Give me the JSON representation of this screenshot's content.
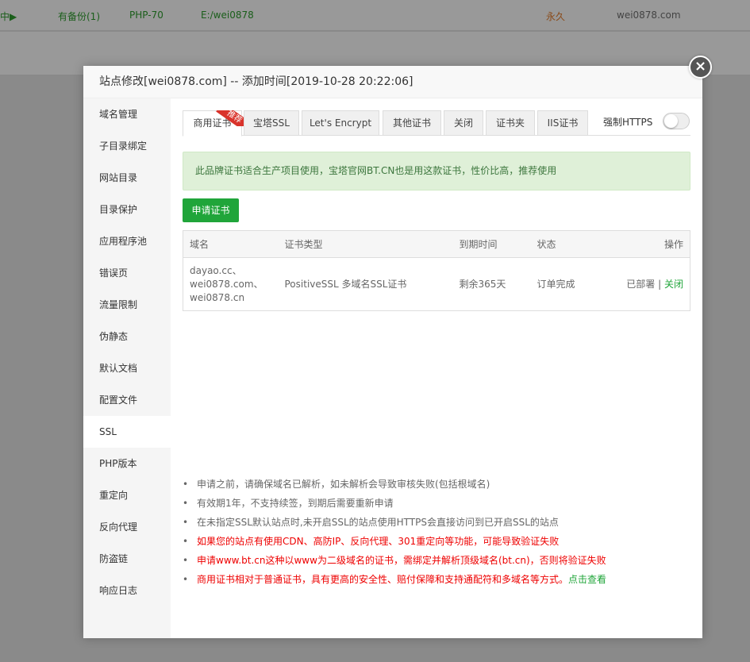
{
  "background": {
    "status": "中▶",
    "backup": "有备份(1)",
    "php": "PHP-70",
    "path": "E:/wei0878",
    "expire": "永久",
    "domain": "wei0878.com"
  },
  "modal": {
    "title": "站点修改[wei0878.com] -- 添加时间[2019-10-28 20:22:06]",
    "close_label": "×"
  },
  "sidebar": {
    "items": [
      {
        "label": "域名管理"
      },
      {
        "label": "子目录绑定"
      },
      {
        "label": "网站目录"
      },
      {
        "label": "目录保护"
      },
      {
        "label": "应用程序池"
      },
      {
        "label": "错误页"
      },
      {
        "label": "流量限制"
      },
      {
        "label": "伪静态"
      },
      {
        "label": "默认文档"
      },
      {
        "label": "配置文件"
      },
      {
        "label": "SSL"
      },
      {
        "label": "PHP版本"
      },
      {
        "label": "重定向"
      },
      {
        "label": "反向代理"
      },
      {
        "label": "防盗链"
      },
      {
        "label": "响应日志"
      }
    ],
    "active": "SSL"
  },
  "tabs": {
    "items": [
      {
        "label": "商用证书"
      },
      {
        "label": "宝塔SSL"
      },
      {
        "label": "Let's Encrypt"
      },
      {
        "label": "其他证书"
      },
      {
        "label": "关闭"
      },
      {
        "label": "证书夹"
      },
      {
        "label": "IIS证书"
      }
    ],
    "ribbon": "推荐",
    "force_https_label": "强制HTTPS",
    "force_https_on": false
  },
  "alert": {
    "text": "此品牌证书适合生产项目使用，宝塔官网BT.CN也是用这款证书，性价比高，推荐使用"
  },
  "apply_button": "申请证书",
  "table": {
    "headers": [
      "域名",
      "证书类型",
      "到期时间",
      "状态",
      "操作"
    ],
    "rows": [
      {
        "domains": [
          "dayao.cc、",
          "wei0878.com、",
          "wei0878.cn"
        ],
        "type": "PositiveSSL 多域名SSL证书",
        "expiry": "剩余365天",
        "status": "订单完成",
        "deployed": "已部署",
        "separator": "|",
        "close": "关闭"
      }
    ]
  },
  "notes": [
    {
      "text": "申请之前，请确保域名已解析，如未解析会导致审核失败(包括根域名)",
      "red": false
    },
    {
      "text": "有效期1年，不支持续签，到期后需要重新申请",
      "red": false
    },
    {
      "text": "在未指定SSL默认站点时,未开启SSL的站点使用HTTPS会直接访问到已开启SSL的站点",
      "red": false
    },
    {
      "text": "如果您的站点有使用CDN、高防IP、反向代理、301重定向等功能，可能导致验证失败",
      "red": true
    },
    {
      "text": "申请www.bt.cn这种以www为二级域名的证书，需绑定并解析顶级域名(bt.cn)，否则将验证失败",
      "red": true
    },
    {
      "text": "商用证书相对于普通证书，具有更高的安全性、赔付保障和支持通配符和多域名等方式。",
      "red": true,
      "link": "点击查看"
    }
  ],
  "colors": {
    "accent_green": "#20a53a",
    "ribbon_red": "#d9332b",
    "warning_red": "#e00"
  }
}
